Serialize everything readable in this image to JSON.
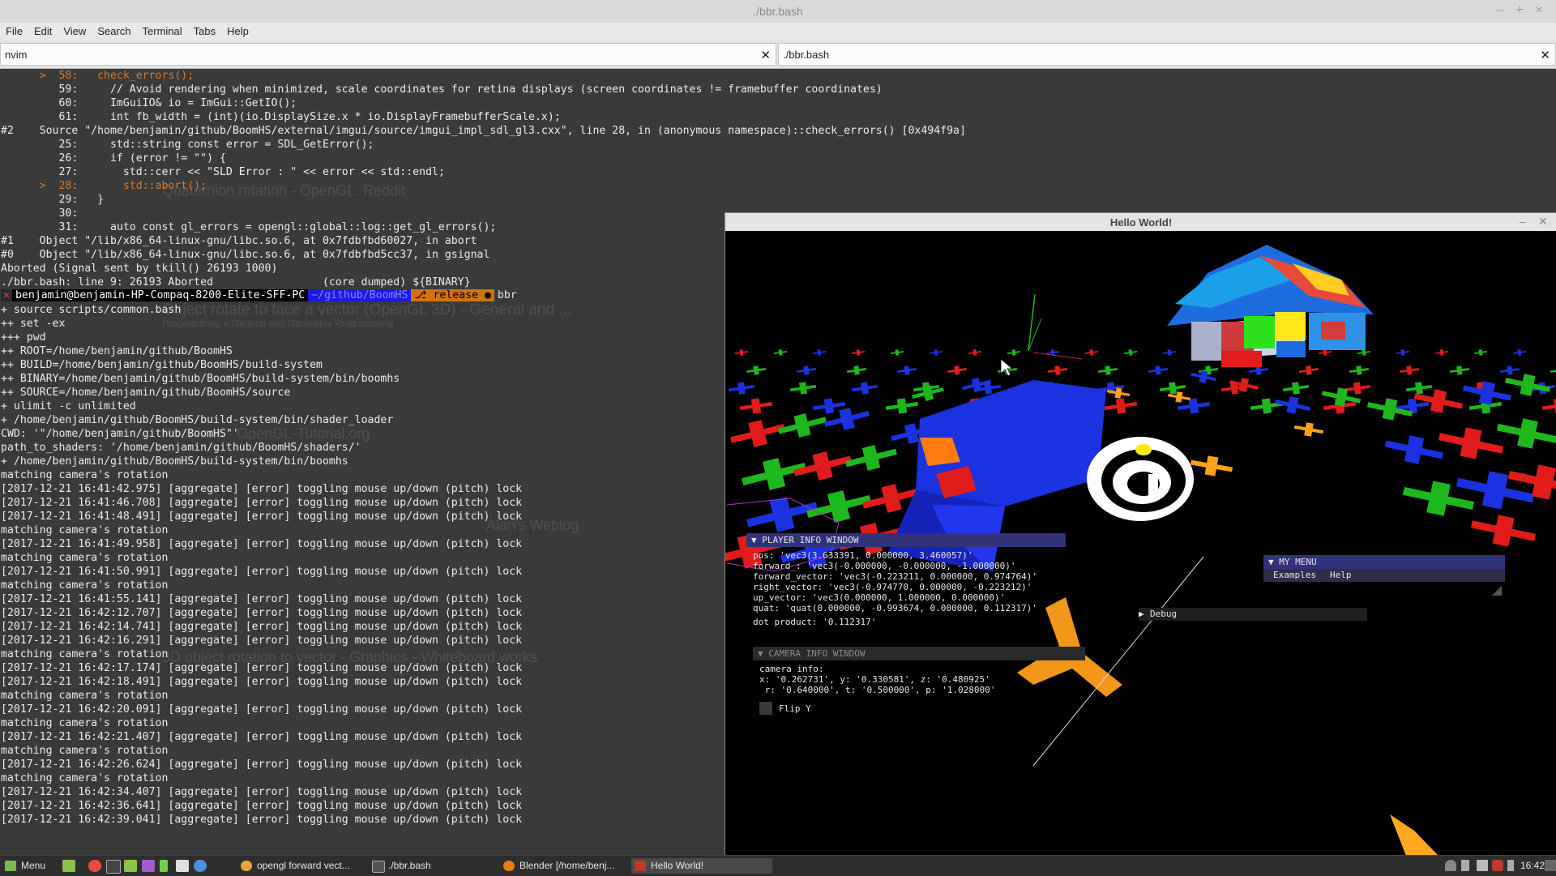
{
  "window": {
    "title": "./bbr.bash"
  },
  "menu": [
    "File",
    "Edit",
    "View",
    "Search",
    "Terminal",
    "Tabs",
    "Help"
  ],
  "tabs": [
    {
      "label": "nvim"
    },
    {
      "label": "./bbr.bash"
    }
  ],
  "terminal": {
    "lines_top": [
      {
        "text": "      >  58:   check_errors();",
        "highlight": true
      },
      {
        "text": "         59:     // Avoid rendering when minimized, scale coordinates for retina displays (screen coordinates != framebuffer coordinates)"
      },
      {
        "text": "         60:     ImGuiIO& io = ImGui::GetIO();"
      },
      {
        "text": "         61:     int fb_width = (int)(io.DisplaySize.x * io.DisplayFramebufferScale.x);"
      },
      {
        "text": "#2    Source \"/home/benjamin/github/BoomHS/external/imgui/source/imgui_impl_sdl_gl3.cxx\", line 28, in (anonymous namespace)::check_errors() [0x494f9a]"
      },
      {
        "text": "         25:     std::string const error = SDL_GetError();"
      },
      {
        "text": "         26:     if (error != \"\") {"
      },
      {
        "text": "         27:       std::cerr << \"SLD Error : \" << error << std::endl;"
      },
      {
        "text": "      >  28:       std::abort();",
        "highlight": true
      },
      {
        "text": "         29:   }"
      },
      {
        "text": "         30:"
      },
      {
        "text": "         31:     auto const gl_errors = opengl::global::log::get_gl_errors();"
      },
      {
        "text": "#1    Object \"/lib/x86_64-linux-gnu/libc.so.6, at 0x7fdbfbd60027, in abort"
      },
      {
        "text": "#0    Object \"/lib/x86_64-linux-gnu/libc.so.6, at 0x7fdbfbd5cc37, in gsignal"
      },
      {
        "text": "Aborted (Signal sent by tkill() 26193 1000)"
      },
      {
        "text": "./bbr.bash: line 9: 26193 Aborted                 (core dumped) ${BINARY}"
      }
    ],
    "prompt": {
      "x": "✕",
      "user": "benjamin@benjamin-HP-Compaq-8200-Elite-SFF-PC",
      "dir": "~/github/BoomHS",
      "git": "⎇ release ●",
      "command": "bbr"
    },
    "lines_bottom": [
      "+ source scripts/common.bash",
      "++ set -ex",
      "+++ pwd",
      "++ ROOT=/home/benjamin/github/BoomHS",
      "++ BUILD=/home/benjamin/github/BoomHS/build-system",
      "++ BINARY=/home/benjamin/github/BoomHS/build-system/bin/boomhs",
      "++ SOURCE=/home/benjamin/github/BoomHS/source",
      "+ ulimit -c unlimited",
      "+ /home/benjamin/github/BoomHS/build-system/bin/shader_loader",
      "CWD: '\"/home/benjamin/github/BoomHS\"'",
      "path_to_shaders: '/home/benjamin/github/BoomHS/shaders/'",
      "+ /home/benjamin/github/BoomHS/build-system/bin/boomhs",
      "matching camera's rotation",
      "[2017-12-21 16:41:42.975] [aggregate] [error] toggling mouse up/down (pitch) lock",
      "[2017-12-21 16:41:46.708] [aggregate] [error] toggling mouse up/down (pitch) lock",
      "[2017-12-21 16:41:48.491] [aggregate] [error] toggling mouse up/down (pitch) lock",
      "matching camera's rotation",
      "[2017-12-21 16:41:49.958] [aggregate] [error] toggling mouse up/down (pitch) lock",
      "matching camera's rotation",
      "[2017-12-21 16:41:50.991] [aggregate] [error] toggling mouse up/down (pitch) lock",
      "matching camera's rotation",
      "[2017-12-21 16:41:55.141] [aggregate] [error] toggling mouse up/down (pitch) lock",
      "[2017-12-21 16:42:12.707] [aggregate] [error] toggling mouse up/down (pitch) lock",
      "[2017-12-21 16:42:14.741] [aggregate] [error] toggling mouse up/down (pitch) lock",
      "[2017-12-21 16:42:16.291] [aggregate] [error] toggling mouse up/down (pitch) lock",
      "matching camera's rotation",
      "[2017-12-21 16:42:17.174] [aggregate] [error] toggling mouse up/down (pitch) lock",
      "[2017-12-21 16:42:18.491] [aggregate] [error] toggling mouse up/down (pitch) lock",
      "matching camera's rotation",
      "[2017-12-21 16:42:20.091] [aggregate] [error] toggling mouse up/down (pitch) lock",
      "matching camera's rotation",
      "[2017-12-21 16:42:21.407] [aggregate] [error] toggling mouse up/down (pitch) lock",
      "matching camera's rotation",
      "[2017-12-21 16:42:26.624] [aggregate] [error] toggling mouse up/down (pitch) lock",
      "matching camera's rotation",
      "[2017-12-21 16:42:34.407] [aggregate] [error] toggling mouse up/down (pitch) lock",
      "[2017-12-21 16:42:36.641] [aggregate] [error] toggling mouse up/down (pitch) lock",
      "[2017-12-21 16:42:39.041] [aggregate] [error] toggling mouse up/down (pitch) lock"
    ]
  },
  "ghost_text": [
    "Quaternion rotation - OpenGL: Reddit",
    "Object rotate to face a vector (OpenGL 3D) - General and ...",
    "Programming > General and Gameplay Programming",
    "Rotations - OpenGL-Tutorial.org",
    "Alan's Weblog",
    "3D object rotation to vector - Graphics - Whiteboard works"
  ],
  "gl_window": {
    "title": "Hello World!",
    "player_info": {
      "header": "PLAYER INFO WINDOW",
      "lines": [
        "pos: 'vec3(3.633391, 0.000000, 3.460057)'",
        "forward_: 'vec3(-0.000000, -0.000000, -1.000000)'",
        "forward_vector: 'vec3(-0.223211, 0.000000, 0.974764)'",
        "right_vector: 'vec3(-0.974770, 0.000000, -0.223212)'",
        "up_vector: 'vec3(0.000000, 1.000000, 0.000000)'",
        "quat: 'quat(0.000000, -0.993674, 0.000000, 0.112317)'",
        "dot product: '0.112317'"
      ]
    },
    "camera_info": {
      "header": "CAMERA INFO WINDOW",
      "lines": [
        "camera info:",
        "x: '0.262731', y: '0.330581', z: '0.480925'",
        " r: '0.640000', t: '0.500000', p: '1.028000'"
      ],
      "checkbox_label": "Flip Y"
    },
    "my_menu": {
      "header": "MY MENU",
      "items": [
        "Examples",
        "Help"
      ]
    },
    "debug_label": "Debug"
  },
  "taskbar": {
    "menu_label": "Menu",
    "windows": [
      {
        "label": "opengl forward vect...",
        "color": "#e8a33c"
      },
      {
        "label": "./bbr.bash",
        "color": "#555555"
      },
      {
        "label": "Blender [/home/benj...",
        "color": "#e87d0d"
      },
      {
        "label": "Hello World!",
        "color": "#c0392b"
      }
    ],
    "clock": "16:42"
  }
}
